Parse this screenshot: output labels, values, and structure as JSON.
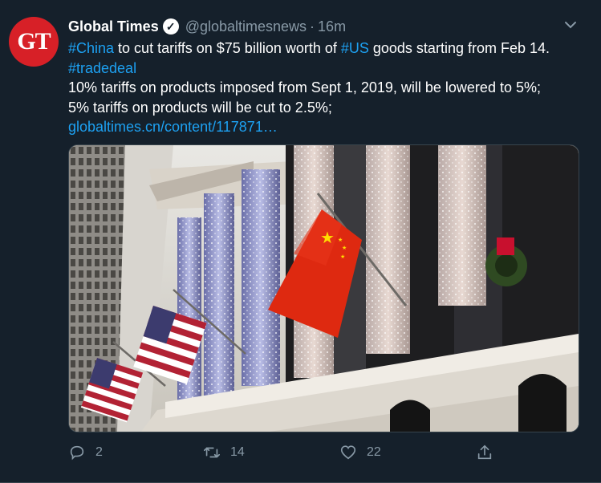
{
  "account": {
    "avatar_text": "GT",
    "name": "Global Times",
    "handle": "@globaltimesnews",
    "separator": "·",
    "time": "16m"
  },
  "tweet": {
    "line1_tag1": "#China",
    "line1_mid": " to cut tariffs on $75 billion worth of ",
    "line1_tag2": "#US",
    "line1_end": " goods starting from Feb 14.",
    "line2_tag": "#tradedeal",
    "line3": "10% tariffs on products imposed from Sept 1, 2019, will be lowered to 5%;",
    "line4": "5% tariffs on products will be cut to 2.5%;",
    "link": "globaltimes.cn/content/117871…"
  },
  "actions": {
    "reply_count": "2",
    "retweet_count": "14",
    "like_count": "22"
  },
  "colors": {
    "background": "#15202b",
    "link": "#1da1f2",
    "muted": "#8899a6",
    "avatar": "#d72027"
  }
}
